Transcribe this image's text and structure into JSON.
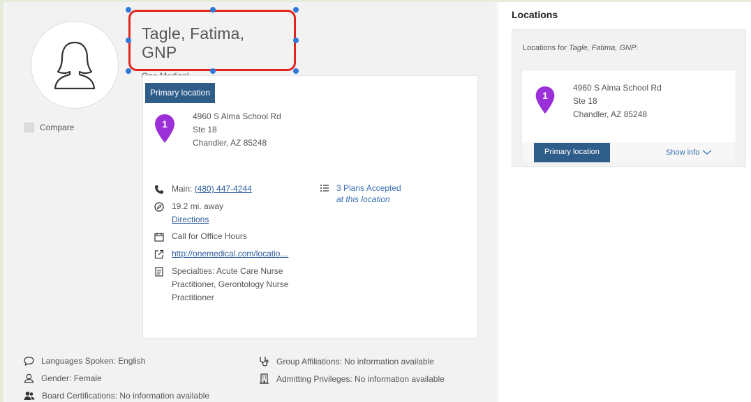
{
  "profile": {
    "name": "Tagle, Fatima, GNP",
    "organization": "One Medical",
    "compare_label": "Compare"
  },
  "primary_card": {
    "badge": "Primary location",
    "pin_number": "1",
    "address": {
      "line1": "4960 S Alma School Rd",
      "line2": "Ste 18",
      "line3": "Chandler, AZ 85248"
    },
    "phone_label": "Main:",
    "phone": "(480) 447-4244",
    "distance": "19.2 mi. away",
    "directions": "Directions",
    "office_hours": "Call for Office Hours",
    "website": "http://onemedical.com/locatio…",
    "specialties": [
      "Specialties: Acute Care Nurse",
      "Practitioner, Gerontology Nurse",
      "Practitioner"
    ],
    "plans_accepted": "3 Plans Accepted",
    "plans_sub": "at this location"
  },
  "details": {
    "languages": "Languages Spoken: English",
    "gender": "Gender: Female",
    "board": "Board Certifications: No information available",
    "group": "Group Affiliations: No information available",
    "admitting": "Admitting Privileges: No information available"
  },
  "locations": {
    "title": "Locations",
    "for_label": "Locations for",
    "for_name": "Tagle, Fatima, GNP",
    "for_suffix": ":",
    "pin_number": "1",
    "address": {
      "line1": "4960 S Alma School Rd",
      "line2": "Ste 18",
      "line3": "Chandler, AZ 85248"
    },
    "primary_button": "Primary location",
    "show_info": "Show info"
  },
  "colors": {
    "accent_blue": "#2f5d8a",
    "pin_purple": "#9b30d9",
    "highlight_red": "#e0261c",
    "handle_blue": "#2f7ad8"
  }
}
